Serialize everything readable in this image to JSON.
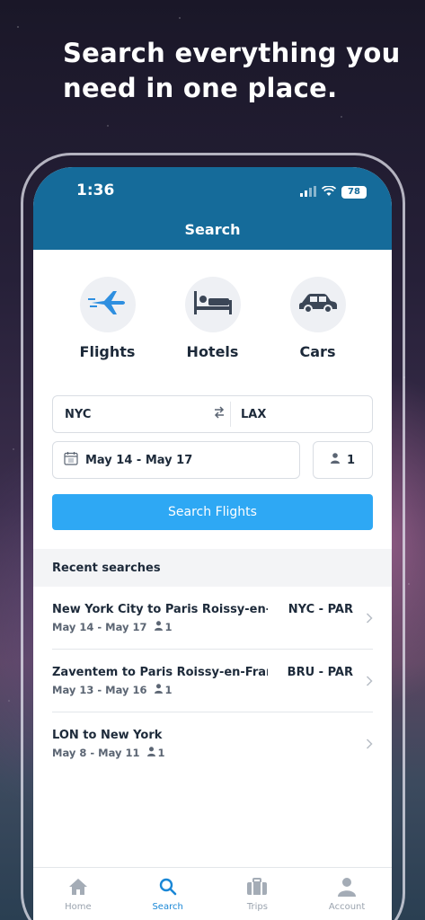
{
  "headline": "Search everything you need in one place.",
  "status": {
    "time": "1:36",
    "battery": "78"
  },
  "screen_title": "Search",
  "categories": [
    {
      "label": "Flights",
      "icon": "plane-icon",
      "active": true
    },
    {
      "label": "Hotels",
      "icon": "bed-icon",
      "active": false
    },
    {
      "label": "Cars",
      "icon": "car-icon",
      "active": false
    }
  ],
  "route": {
    "origin": "NYC",
    "destination": "LAX"
  },
  "dates": {
    "value": "May 14 - May 17"
  },
  "travelers": {
    "count": "1"
  },
  "search_button": "Search Flights",
  "recent": {
    "header": "Recent searches",
    "items": [
      {
        "title": "New York City to Paris Roissy-en-...",
        "code": "NYC - PAR",
        "dates": "May 14 - May 17",
        "travelers": "1"
      },
      {
        "title": "Zaventem to Paris Roissy-en-France",
        "code": "BRU - PAR",
        "dates": "May 13 - May 16",
        "travelers": "1"
      },
      {
        "title": "LON to New York",
        "code": "",
        "dates": "May 8 - May 11",
        "travelers": "1"
      }
    ]
  },
  "tabs": [
    {
      "label": "Home",
      "icon": "home-icon",
      "active": false
    },
    {
      "label": "Search",
      "icon": "search-icon",
      "active": true
    },
    {
      "label": "Trips",
      "icon": "suitcase-icon",
      "active": false
    },
    {
      "label": "Account",
      "icon": "person-icon",
      "active": false
    }
  ],
  "colors": {
    "header": "#156b9a",
    "primary_button": "#2ea8f4",
    "active_tab": "#1a87d6",
    "plane": "#2e8fe0"
  }
}
